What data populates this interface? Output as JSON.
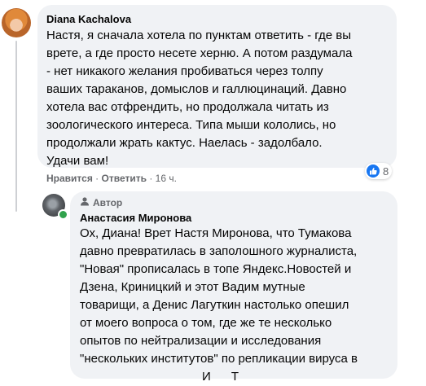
{
  "comment": {
    "author": "Diana Kachalova",
    "lines": [
      "Настя, я сначала хотела по пунктам ответить - где вы",
      "врете, а где просто несете херню. А потом раздумала",
      "- нет никакого желания пробиваться через толпу",
      "ваших тараканов, домыслов и галлюцинаций. Давно",
      "хотела вас отфрендить, но продолжала читать из",
      "зоологического интереса. Типа мыши кололись, но",
      "продолжали жрать кактус. Наелась - задолбало.",
      "Удачи вам!"
    ],
    "like_label": "Нравится",
    "reply_label": "Ответить",
    "separator": "·",
    "time": "16 ч.",
    "reaction_count": "8"
  },
  "reply": {
    "badge": "Автор",
    "author": "Анастасия Миронова",
    "lines": [
      "Ох, Диана! Врет Настя Миронова, что Тумакова",
      "давно превратилась в заполошного журналиста,",
      "\"Новая\" прописалась в топе Яндекс.Новостей и",
      "Дзена, Криницкий и этот Вадим мутные",
      "товарищи, а Денис Лагуткин настолько опешил",
      "от моего вопроса о том, где же те несколько",
      "опытов по нейтрализации и исследования",
      "\"нескольких институтов\" по репликации вируса в",
      "                                    И      Т"
    ]
  },
  "colors": {
    "bubble": "#f0f2f5",
    "meta": "#65676b",
    "like_blue": "#1877f2",
    "online_green": "#31a24c"
  },
  "icons": [
    "avatar",
    "like-reaction-icon",
    "author-badge-icon",
    "online-status-dot"
  ]
}
